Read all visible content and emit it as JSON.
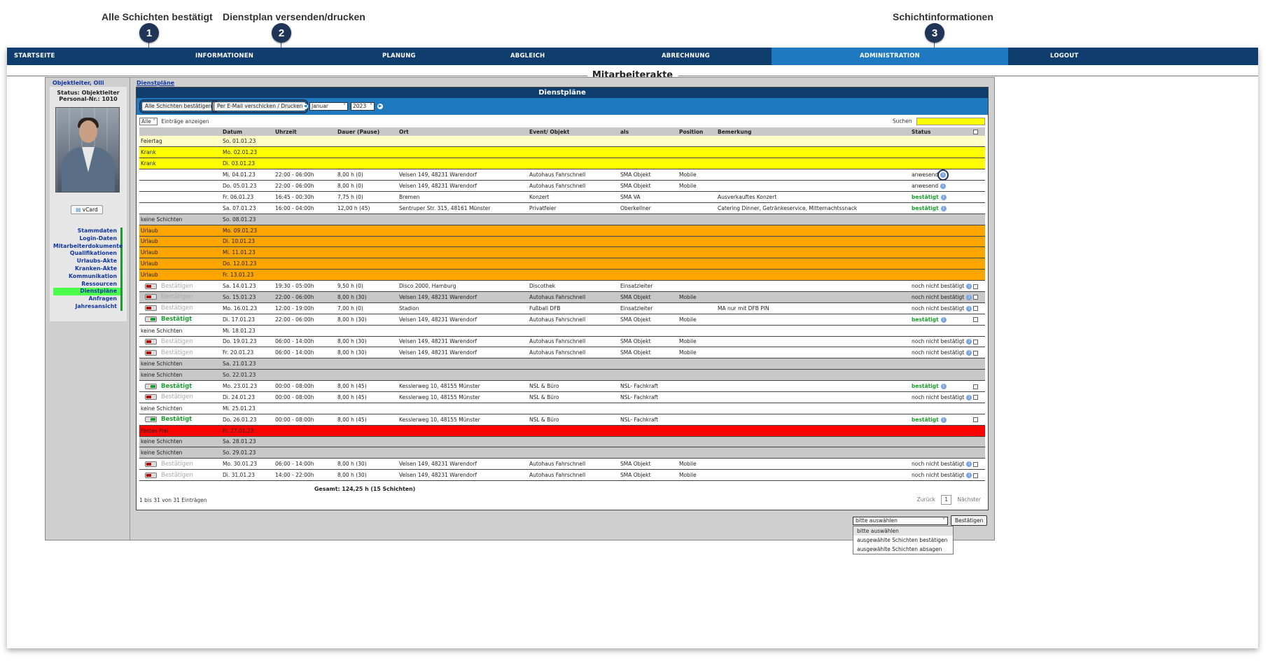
{
  "callouts": [
    {
      "num": "1",
      "label": "Alle Schichten bestätigt"
    },
    {
      "num": "2",
      "label": "Dienstplan versenden/drucken"
    },
    {
      "num": "3",
      "label": "Schichtinformationen"
    }
  ],
  "nav": {
    "items": [
      "STARTSEITE",
      "INFORMATIONEN",
      "PLANUNG",
      "ABGLEICH",
      "ABRECHNUNG",
      "ADMINISTRATION",
      "LOGOUT"
    ],
    "active": "ADMINISTRATION",
    "accent": "#1e79c1",
    "bg": "#0f3d6e"
  },
  "page_title": "Mitarbeiterakte",
  "sidebar": {
    "name": "Objektleiter, Olli",
    "status": "Status: Objektleiter",
    "personal_nr": "Personal-Nr.: 1010",
    "vcard_label": "vCard",
    "menu": [
      "Stammdaten",
      "Login-Daten",
      "Mitarbeiterdokumente",
      "Qualifikationen",
      "Urlaubs-Akte",
      "Kranken-Akte",
      "Kommunikation",
      "Ressourcen",
      "Dienstpläne",
      "Anfragen",
      "Jahresansicht"
    ],
    "active_menu": "Dienstpläne"
  },
  "main": {
    "breadcrumb": "Dienstpläne",
    "panel_title": "Dienstpläne",
    "btn_confirm_all": "Alle Schichten bestätigen",
    "btn_email_print": "Per E-Mail verschicken / Drucken",
    "month": "Januar",
    "year": "2023",
    "entries_select": "Alle",
    "entries_label": "Einträge anzeigen",
    "search_label": "Suchen",
    "columns": [
      "",
      "Datum",
      "Uhrzeit",
      "Dauer (Pause)",
      "Ort",
      "Event/ Objekt",
      "als",
      "Position",
      "Bemerkung",
      "Status",
      ""
    ],
    "rows": [
      {
        "type": "feiertag",
        "label": "Feiertag",
        "date": "So. 01.01.23"
      },
      {
        "type": "krank",
        "label": "Krank",
        "date": "Mo. 02.01.23"
      },
      {
        "type": "krank",
        "label": "Krank",
        "date": "Di. 03.01.23"
      },
      {
        "type": "normal",
        "date": "Mi. 04.01.23",
        "time": "22:00 - 06:00h",
        "dur": "8,00 h (0)",
        "ort": "Velsen 149, 48231 Warendorf",
        "event": "Autohaus Fahrschnell",
        "als": "SMA Objekt",
        "pos": "Mobile",
        "note": "",
        "status": "anwesend",
        "st": "plain",
        "ring": true
      },
      {
        "type": "normal",
        "date": "Do. 05.01.23",
        "time": "22:00 - 06:00h",
        "dur": "8,00 h (0)",
        "ort": "Velsen 149, 48231 Warendorf",
        "event": "Autohaus Fahrschnell",
        "als": "SMA Objekt",
        "pos": "Mobile",
        "note": "",
        "status": "anwesend",
        "st": "plain"
      },
      {
        "type": "normal",
        "date": "Fr. 06.01.23",
        "time": "16:45 - 00:30h",
        "dur": "7,75 h (0)",
        "ort": "Bremen",
        "event": "Konzert",
        "als": "SMA VA",
        "pos": "",
        "note": "Ausverkauftes Konzert",
        "status": "bestätigt",
        "st": "green"
      },
      {
        "type": "normal",
        "date": "Sa. 07.01.23",
        "time": "16:00 - 04:00h",
        "dur": "12,00 h (45)",
        "ort": "Sentruper Str. 315, 48161 Münster",
        "event": "Privatfeier",
        "als": "Oberkellner",
        "pos": "",
        "note": "Catering Dinner, Getränkeservice, Mitternachtssnack",
        "status": "bestätigt",
        "st": "green"
      },
      {
        "type": "keine",
        "label": "keine Schichten",
        "date": "So. 08.01.23"
      },
      {
        "type": "urlaub",
        "label": "Urlaub",
        "date": "Mo. 09.01.23"
      },
      {
        "type": "urlaub",
        "label": "Urlaub",
        "date": "Di. 10.01.23"
      },
      {
        "type": "urlaub",
        "label": "Urlaub",
        "date": "Mi. 11.01.23"
      },
      {
        "type": "urlaub",
        "label": "Urlaub",
        "date": "Do. 12.01.23"
      },
      {
        "type": "urlaub",
        "label": "Urlaub",
        "date": "Fr. 13.01.23"
      },
      {
        "type": "shift",
        "toggle": "red",
        "tlabel": "Bestätigen",
        "date": "Sa. 14.01.23",
        "time": "19:30 - 05:00h",
        "dur": "9,50 h (0)",
        "ort": "Disco 2000, Hamburg",
        "event": "Discothek",
        "als": "Einsatzleiter",
        "pos": "",
        "note": "",
        "status": "noch nicht bestätigt",
        "st": "plain",
        "cb": true
      },
      {
        "type": "shift",
        "grey": true,
        "toggle": "red",
        "tlabel": "Bestätigen",
        "date": "So. 15.01.23",
        "time": "22:00 - 06:00h",
        "dur": "8,00 h (30)",
        "ort": "Velsen 149, 48231 Warendorf",
        "event": "Autohaus Fahrschnell",
        "als": "SMA Objekt",
        "pos": "Mobile",
        "note": "",
        "status": "noch nicht bestätigt",
        "st": "plain",
        "cb": true
      },
      {
        "type": "shift",
        "toggle": "red",
        "tlabel": "Bestätigen",
        "date": "Mo. 16.01.23",
        "time": "12:00 - 19:00h",
        "dur": "7,00 h (0)",
        "ort": "Stadion",
        "event": "Fußball DFB",
        "als": "Einsatzleiter",
        "pos": "",
        "note": "MA nur mit DFB PIN",
        "status": "noch nicht bestätigt",
        "st": "plain",
        "cb": true
      },
      {
        "type": "shift",
        "toggle": "green",
        "tlabel": "Bestätigt",
        "date": "Di. 17.01.23",
        "time": "22:00 - 06:00h",
        "dur": "8,00 h (30)",
        "ort": "Velsen 149, 48231 Warendorf",
        "event": "Autohaus Fahrschnell",
        "als": "SMA Objekt",
        "pos": "Mobile",
        "note": "",
        "status": "bestätigt",
        "st": "green",
        "cb": true
      },
      {
        "type": "keine-w",
        "label": "keine Schichten",
        "date": "Mi. 18.01.23"
      },
      {
        "type": "shift",
        "toggle": "red",
        "tlabel": "Bestätigen",
        "date": "Do. 19.01.23",
        "time": "06:00 - 14:00h",
        "dur": "8,00 h (30)",
        "ort": "Velsen 149, 48231 Warendorf",
        "event": "Autohaus Fahrschnell",
        "als": "SMA Objekt",
        "pos": "Mobile",
        "note": "",
        "status": "noch nicht bestätigt",
        "st": "plain",
        "cb": true
      },
      {
        "type": "shift",
        "toggle": "red",
        "tlabel": "Bestätigen",
        "date": "Fr. 20.01.23",
        "time": "06:00 - 14:00h",
        "dur": "8,00 h (30)",
        "ort": "Velsen 149, 48231 Warendorf",
        "event": "Autohaus Fahrschnell",
        "als": "SMA Objekt",
        "pos": "Mobile",
        "note": "",
        "status": "noch nicht bestätigt",
        "st": "plain",
        "cb": true
      },
      {
        "type": "keine",
        "label": "keine Schichten",
        "date": "Sa. 21.01.23"
      },
      {
        "type": "keine",
        "label": "keine Schichten",
        "date": "So. 22.01.23"
      },
      {
        "type": "shift",
        "toggle": "green",
        "tlabel": "Bestätigt",
        "date": "Mo. 23.01.23",
        "time": "00:00 - 08:00h",
        "dur": "8,00 h (45)",
        "ort": "Kesslerweg 10, 48155 Münster",
        "event": "NSL & Büro",
        "als": "NSL- Fachkraft",
        "pos": "",
        "note": "",
        "status": "bestätigt",
        "st": "green",
        "cb": true
      },
      {
        "type": "shift",
        "toggle": "red",
        "tlabel": "Bestätigen",
        "date": "Di. 24.01.23",
        "time": "00:00 - 08:00h",
        "dur": "8,00 h (45)",
        "ort": "Kesslerweg 10, 48155 Münster",
        "event": "NSL & Büro",
        "als": "NSL- Fachkraft",
        "pos": "",
        "note": "",
        "status": "noch nicht bestätigt",
        "st": "plain",
        "cb": true
      },
      {
        "type": "keine-w",
        "label": "keine Schichten",
        "date": "Mi. 25.01.23"
      },
      {
        "type": "shift",
        "toggle": "green",
        "tlabel": "Bestätigt",
        "date": "Do. 26.01.23",
        "time": "00:00 - 08:00h",
        "dur": "8,00 h (45)",
        "ort": "Kesslerweg 10, 48155 Münster",
        "event": "NSL & Büro",
        "als": "NSL- Fachkraft",
        "pos": "",
        "note": "",
        "status": "bestätigt",
        "st": "green",
        "cb": true
      },
      {
        "type": "frei",
        "label": "Festes Frei",
        "date": "Fr. 27.01.23"
      },
      {
        "type": "keine",
        "label": "keine Schichten",
        "date": "Sa. 28.01.23"
      },
      {
        "type": "keine",
        "label": "keine Schichten",
        "date": "So. 29.01.23"
      },
      {
        "type": "shift",
        "toggle": "red",
        "tlabel": "Bestätigen",
        "date": "Mo. 30.01.23",
        "time": "06:00 - 14:00h",
        "dur": "8,00 h (30)",
        "ort": "Velsen 149, 48231 Warendorf",
        "event": "Autohaus Fahrschnell",
        "als": "SMA Objekt",
        "pos": "Mobile",
        "note": "",
        "status": "noch nicht bestätigt",
        "st": "plain",
        "cb": true
      },
      {
        "type": "shift",
        "toggle": "red",
        "tlabel": "Bestätigen",
        "date": "Di. 31.01.23",
        "time": "14:00 - 22:00h",
        "dur": "8,00 h (30)",
        "ort": "Velsen 149, 48231 Warendorf",
        "event": "Autohaus Fahrschnell",
        "als": "SMA Objekt",
        "pos": "Mobile",
        "note": "",
        "status": "noch nicht bestätigt",
        "st": "plain",
        "cb": true
      }
    ],
    "total": "Gesamt:  124,25 h (15 Schichten)",
    "count_info": "1 bis 31 von 31 Einträgen",
    "pager": {
      "prev": "Zurück",
      "page": "1",
      "next": "Nächster"
    },
    "bulk": {
      "selected": "bitte auswählen",
      "button": "Bestätigen",
      "options": [
        "bitte auswählen",
        "ausgewählte Schichten bestätigen",
        "ausgewählte Schichten absagen"
      ]
    }
  }
}
